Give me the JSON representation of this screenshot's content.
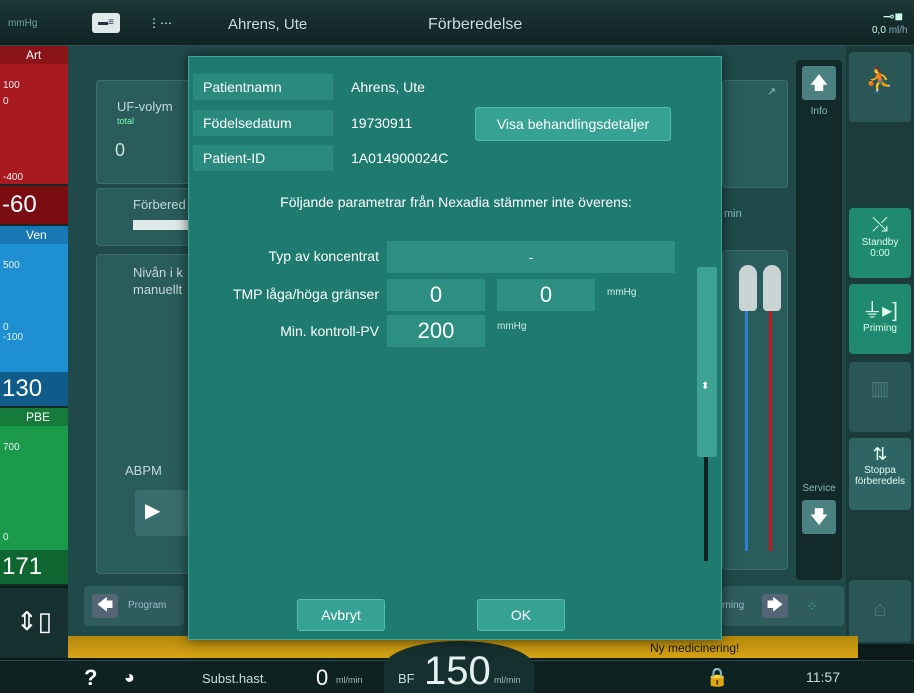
{
  "topbar": {
    "unit": "mmHg",
    "patient_name": "Ahrens, Ute",
    "phase": "Förberedelse",
    "right_value": "0,0",
    "right_unit": "ml/h"
  },
  "pressures": {
    "art": {
      "label": "Art",
      "tick_top": "100",
      "tick_zero": "0",
      "tick_bottom": "-400",
      "value": "-60",
      "color": "#c0181e"
    },
    "ven": {
      "label": "Ven",
      "tick_top": "500",
      "tick_zero": "0",
      "tick_bottom": "-100",
      "value": "130",
      "color": "#1e8fd0"
    },
    "pbe": {
      "label": "PBE",
      "tick_top": "700",
      "tick_zero": "0",
      "value": "171",
      "color": "#1a9a4a"
    }
  },
  "background": {
    "uf_label": "UF-volym",
    "uf_sub": "total",
    "uf_value": "0",
    "forbered": "Förbered",
    "nivan_line1": "Nivån i k",
    "nivan_line2": "manuellt",
    "abpm": "ABPM",
    "program": "Program",
    "info": "Info",
    "service": "Service",
    "min": "min",
    "rning": "rning"
  },
  "right_buttons": {
    "standby": "Standby",
    "standby_time": "0:00",
    "priming": "Priming",
    "stoppa": "Stoppa",
    "forberedels": "förberedels"
  },
  "medication_notice": "Ny medicinering!",
  "bottombar": {
    "help": "?",
    "subst_label": "Subst.hast.",
    "subst_value": "0",
    "subst_unit": "ml/min",
    "bf_label": "BF",
    "bf_value": "150",
    "bf_unit": "ml/min",
    "time": "11:57"
  },
  "dialog": {
    "patient_name_label": "Patientnamn",
    "patient_name_value": "Ahrens, Ute",
    "dob_label": "Födelsedatum",
    "dob_value": "19730911",
    "pid_label": "Patient-ID",
    "pid_value": "1A014900024C",
    "details_button": "Visa behandlingsdetaljer",
    "mismatch_message": "Följande parametrar från Nexadia stämmer inte överens:",
    "params": {
      "concentrate_label": "Typ av koncentrat",
      "concentrate_value": "-",
      "tmp_label": "TMP låga/höga gränser",
      "tmp_low": "0",
      "tmp_high": "0",
      "tmp_unit": "mmHg",
      "pv_label": "Min. kontroll-PV",
      "pv_value": "200",
      "pv_unit": "mmHg"
    },
    "cancel_button": "Avbryt",
    "ok_button": "OK"
  }
}
